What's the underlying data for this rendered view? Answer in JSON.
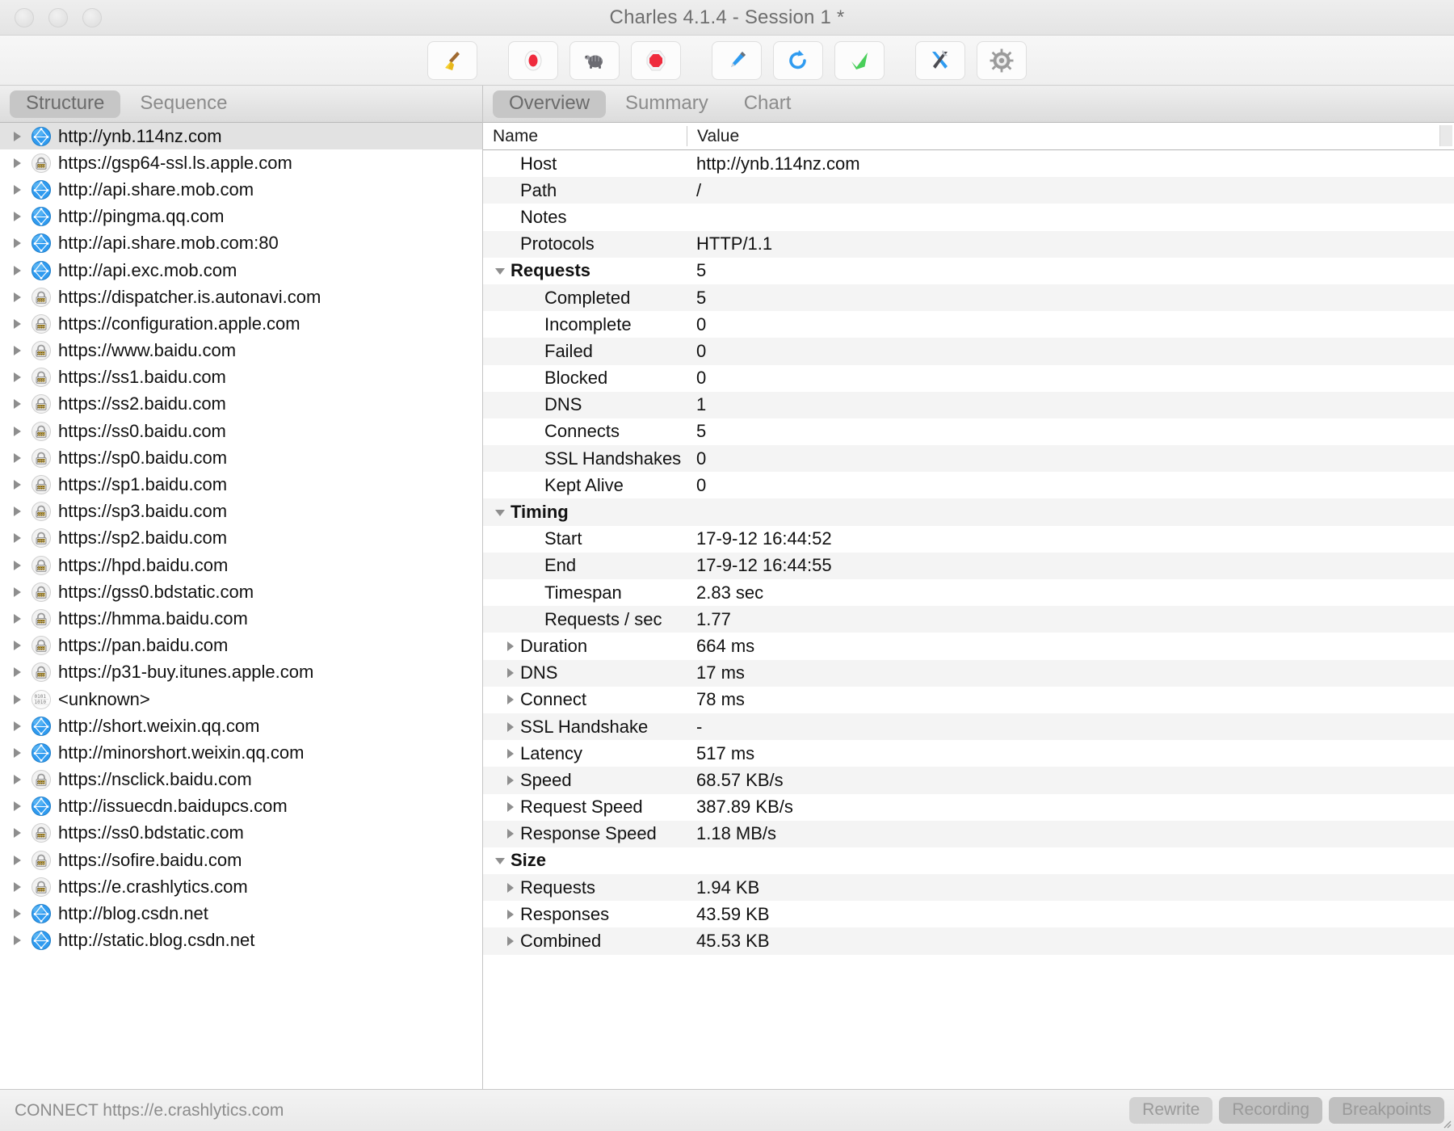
{
  "window": {
    "title": "Charles 4.1.4 - Session 1 *",
    "controls": [
      "close",
      "minimize",
      "zoom"
    ]
  },
  "toolbar": {
    "buttons": [
      {
        "name": "clear-session-button",
        "icon": "broom-icon",
        "label": "Clear"
      },
      {
        "name": "start-recording-button",
        "icon": "record-icon",
        "label": "Record"
      },
      {
        "name": "throttle-button",
        "icon": "turtle-icon",
        "label": "Throttle"
      },
      {
        "name": "stop-button",
        "icon": "stop-octagon-icon",
        "label": "Stop"
      },
      {
        "name": "compose-button",
        "icon": "pen-icon",
        "label": "Compose"
      },
      {
        "name": "repeat-button",
        "icon": "refresh-icon",
        "label": "Repeat"
      },
      {
        "name": "validate-button",
        "icon": "checkmark-icon",
        "label": "Validate"
      },
      {
        "name": "tools-button",
        "icon": "wrench-screwdriver-icon",
        "label": "Tools"
      },
      {
        "name": "settings-button",
        "icon": "gear-icon",
        "label": "Settings"
      }
    ]
  },
  "left_panel": {
    "tabs": [
      {
        "label": "Structure",
        "active": true
      },
      {
        "label": "Sequence",
        "active": false
      }
    ],
    "tree": [
      {
        "label": "http://ynb.114nz.com",
        "icon": "globe-icon",
        "selected": true
      },
      {
        "label": "https://gsp64-ssl.ls.apple.com",
        "icon": "lock-icon",
        "selected": false
      },
      {
        "label": "http://api.share.mob.com",
        "icon": "globe-icon",
        "selected": false
      },
      {
        "label": "http://pingma.qq.com",
        "icon": "globe-icon",
        "selected": false
      },
      {
        "label": "http://api.share.mob.com:80",
        "icon": "globe-icon",
        "selected": false
      },
      {
        "label": "http://api.exc.mob.com",
        "icon": "globe-icon",
        "selected": false
      },
      {
        "label": "https://dispatcher.is.autonavi.com",
        "icon": "lock-icon",
        "selected": false
      },
      {
        "label": "https://configuration.apple.com",
        "icon": "lock-icon",
        "selected": false
      },
      {
        "label": "https://www.baidu.com",
        "icon": "lock-icon",
        "selected": false
      },
      {
        "label": "https://ss1.baidu.com",
        "icon": "lock-icon",
        "selected": false
      },
      {
        "label": "https://ss2.baidu.com",
        "icon": "lock-icon",
        "selected": false
      },
      {
        "label": "https://ss0.baidu.com",
        "icon": "lock-icon",
        "selected": false
      },
      {
        "label": "https://sp0.baidu.com",
        "icon": "lock-icon",
        "selected": false
      },
      {
        "label": "https://sp1.baidu.com",
        "icon": "lock-icon",
        "selected": false
      },
      {
        "label": "https://sp3.baidu.com",
        "icon": "lock-icon",
        "selected": false
      },
      {
        "label": "https://sp2.baidu.com",
        "icon": "lock-icon",
        "selected": false
      },
      {
        "label": "https://hpd.baidu.com",
        "icon": "lock-icon",
        "selected": false
      },
      {
        "label": "https://gss0.bdstatic.com",
        "icon": "lock-icon",
        "selected": false
      },
      {
        "label": "https://hmma.baidu.com",
        "icon": "lock-icon",
        "selected": false
      },
      {
        "label": "https://pan.baidu.com",
        "icon": "lock-icon",
        "selected": false
      },
      {
        "label": "https://p31-buy.itunes.apple.com",
        "icon": "lock-icon",
        "selected": false
      },
      {
        "label": "<unknown>",
        "icon": "binary-icon",
        "selected": false
      },
      {
        "label": "http://short.weixin.qq.com",
        "icon": "globe-icon",
        "selected": false
      },
      {
        "label": "http://minorshort.weixin.qq.com",
        "icon": "globe-icon",
        "selected": false
      },
      {
        "label": "https://nsclick.baidu.com",
        "icon": "lock-icon",
        "selected": false
      },
      {
        "label": "http://issuecdn.baidupcs.com",
        "icon": "globe-icon",
        "selected": false
      },
      {
        "label": "https://ss0.bdstatic.com",
        "icon": "lock-icon",
        "selected": false
      },
      {
        "label": "https://sofire.baidu.com",
        "icon": "lock-icon",
        "selected": false
      },
      {
        "label": "https://e.crashlytics.com",
        "icon": "lock-icon",
        "selected": false
      },
      {
        "label": "http://blog.csdn.net",
        "icon": "globe-icon",
        "selected": false
      },
      {
        "label": "http://static.blog.csdn.net",
        "icon": "globe-icon",
        "selected": false
      }
    ]
  },
  "right_panel": {
    "tabs": [
      {
        "label": "Overview",
        "active": true
      },
      {
        "label": "Summary",
        "active": false
      },
      {
        "label": "Chart",
        "active": false
      }
    ],
    "columns": {
      "name": "Name",
      "value": "Value"
    },
    "rows": [
      {
        "name": "Host",
        "value": "http://ynb.114nz.com",
        "level": 1,
        "tri": "none",
        "bold": false
      },
      {
        "name": "Path",
        "value": "/",
        "level": 1,
        "tri": "none",
        "bold": false
      },
      {
        "name": "Notes",
        "value": "",
        "level": 1,
        "tri": "none",
        "bold": false
      },
      {
        "name": "Protocols",
        "value": "HTTP/1.1",
        "level": 1,
        "tri": "none",
        "bold": false
      },
      {
        "name": "Requests",
        "value": "5",
        "level": 0,
        "tri": "down",
        "bold": true
      },
      {
        "name": "Completed",
        "value": "5",
        "level": 2,
        "tri": "none",
        "bold": false
      },
      {
        "name": "Incomplete",
        "value": "0",
        "level": 2,
        "tri": "none",
        "bold": false
      },
      {
        "name": "Failed",
        "value": "0",
        "level": 2,
        "tri": "none",
        "bold": false
      },
      {
        "name": "Blocked",
        "value": "0",
        "level": 2,
        "tri": "none",
        "bold": false
      },
      {
        "name": "DNS",
        "value": "1",
        "level": 2,
        "tri": "none",
        "bold": false
      },
      {
        "name": "Connects",
        "value": "5",
        "level": 2,
        "tri": "none",
        "bold": false
      },
      {
        "name": "SSL Handshakes",
        "value": "0",
        "level": 2,
        "tri": "none",
        "bold": false
      },
      {
        "name": "Kept Alive",
        "value": "0",
        "level": 2,
        "tri": "none",
        "bold": false
      },
      {
        "name": "Timing",
        "value": "",
        "level": 0,
        "tri": "down",
        "bold": true
      },
      {
        "name": "Start",
        "value": "17-9-12 16:44:52",
        "level": 2,
        "tri": "none",
        "bold": false
      },
      {
        "name": "End",
        "value": "17-9-12 16:44:55",
        "level": 2,
        "tri": "none",
        "bold": false
      },
      {
        "name": "Timespan",
        "value": "2.83 sec",
        "level": 2,
        "tri": "none",
        "bold": false
      },
      {
        "name": "Requests / sec",
        "value": "1.77",
        "level": 2,
        "tri": "none",
        "bold": false
      },
      {
        "name": "Duration",
        "value": "664 ms",
        "level": 1,
        "tri": "right",
        "bold": false
      },
      {
        "name": "DNS",
        "value": "17 ms",
        "level": 1,
        "tri": "right",
        "bold": false
      },
      {
        "name": "Connect",
        "value": "78 ms",
        "level": 1,
        "tri": "right",
        "bold": false
      },
      {
        "name": "SSL Handshake",
        "value": "-",
        "level": 1,
        "tri": "right",
        "bold": false
      },
      {
        "name": "Latency",
        "value": "517 ms",
        "level": 1,
        "tri": "right",
        "bold": false
      },
      {
        "name": "Speed",
        "value": "68.57 KB/s",
        "level": 1,
        "tri": "right",
        "bold": false
      },
      {
        "name": "Request Speed",
        "value": "387.89 KB/s",
        "level": 1,
        "tri": "right",
        "bold": false
      },
      {
        "name": "Response Speed",
        "value": "1.18 MB/s",
        "level": 1,
        "tri": "right",
        "bold": false
      },
      {
        "name": "Size",
        "value": "",
        "level": 0,
        "tri": "down",
        "bold": true
      },
      {
        "name": "Requests",
        "value": "1.94 KB",
        "level": 1,
        "tri": "right",
        "bold": false
      },
      {
        "name": "Responses",
        "value": "43.59 KB",
        "level": 1,
        "tri": "right",
        "bold": false
      },
      {
        "name": "Combined",
        "value": "45.53 KB",
        "level": 1,
        "tri": "right",
        "bold": false
      }
    ]
  },
  "status_bar": {
    "message": "CONNECT https://e.crashlytics.com",
    "buttons": [
      {
        "label": "Rewrite",
        "state": "light",
        "name": "rewrite-toggle"
      },
      {
        "label": "Recording",
        "state": "dark",
        "name": "recording-toggle"
      },
      {
        "label": "Breakpoints",
        "state": "dark",
        "name": "breakpoints-toggle"
      }
    ]
  },
  "colors": {
    "selection": "#e2e2e2",
    "row_alt": "#f4f4f4",
    "tab_active": "#c6c6c6",
    "record_red": "#ef2b3d",
    "check_green": "#49cf5a",
    "globe_blue": "#3fa9f5"
  }
}
